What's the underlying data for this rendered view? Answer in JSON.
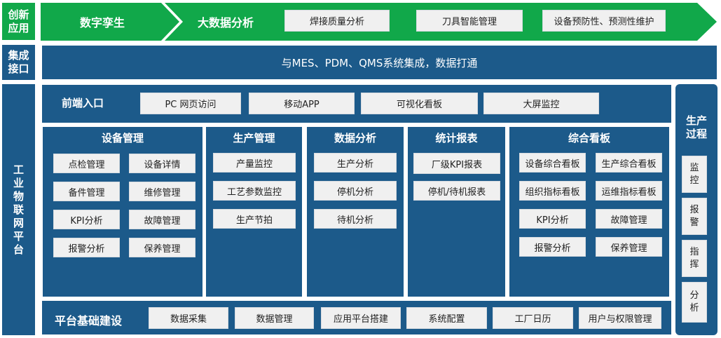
{
  "colors": {
    "navy": "#1c5a8a",
    "green": "#11a84a",
    "white": "#ffffff",
    "pill": "#f0f0f0"
  },
  "rows": {
    "innovation": {
      "label_lines": [
        "创新",
        "应用"
      ],
      "arrow1": "数字孪生",
      "arrow2": "大数据分析",
      "items": [
        "焊接质量分析",
        "刀具智能管理",
        "设备预防性、预测性维护"
      ]
    },
    "integration": {
      "label_lines": [
        "集成",
        "接口"
      ],
      "text": "与MES、PDM、QMS系统集成，数据打通"
    },
    "platform": {
      "label_chars": [
        "工",
        "业",
        "物",
        "联",
        "网",
        "平",
        "台"
      ]
    }
  },
  "frontend": {
    "title": "前端入口",
    "items": [
      "PC 网页访问",
      "移动APP",
      "可视化看板",
      "大屏监控"
    ]
  },
  "columns": {
    "equipment": {
      "title": "设备管理",
      "items": [
        "点检管理",
        "设备详情",
        "备件管理",
        "维修管理",
        "KPI分析",
        "故障管理",
        "报警分析",
        "保养管理"
      ]
    },
    "production": {
      "title": "生产管理",
      "items": [
        "产量监控",
        "工艺参数监控",
        "生产节拍"
      ]
    },
    "analysis": {
      "title": "数据分析",
      "items": [
        "生产分析",
        "停机分析",
        "待机分析"
      ]
    },
    "reports": {
      "title": "统计报表",
      "items": [
        "厂级KPI报表",
        "停机/待机报表"
      ]
    },
    "dashboard": {
      "title": "综合看板",
      "items": [
        "设备综合看板",
        "生产综合看板",
        "组织指标看板",
        "运维指标看板",
        "KPI分析",
        "故障管理",
        "报警分析",
        "保养管理"
      ]
    }
  },
  "foundation": {
    "title": "平台基础建设",
    "items": [
      "数据采集",
      "数据管理",
      "应用平台搭建",
      "系统配置",
      "工厂日历",
      "用户与权限管理"
    ]
  },
  "process": {
    "title_lines": [
      "生产",
      "过程"
    ],
    "items": [
      {
        "chars": [
          "监",
          "控"
        ]
      },
      {
        "chars": [
          "报",
          "警"
        ]
      },
      {
        "chars": [
          "指",
          "挥"
        ]
      },
      {
        "chars": [
          "分",
          "析"
        ]
      }
    ]
  }
}
